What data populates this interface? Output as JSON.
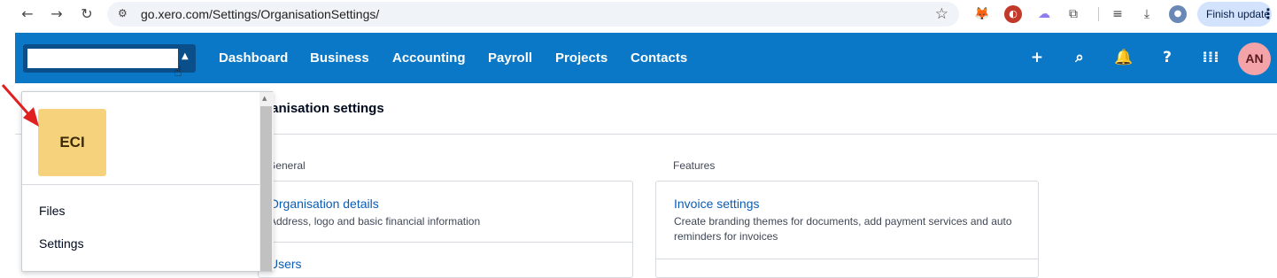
{
  "browser": {
    "back_icon": "←",
    "forward_icon": "→",
    "reload_icon": "↻",
    "site_info_icon": "⚙",
    "url": "go.xero.com/Settings/OrganisationSettings/",
    "bookmark_icon": "☆",
    "finish_update_label": "Finish update",
    "menu_icon": "⋮"
  },
  "header": {
    "org_name": "",
    "nav": [
      "Dashboard",
      "Business",
      "Accounting",
      "Payroll",
      "Projects",
      "Contacts"
    ],
    "user_initials": "AN",
    "colors": {
      "header_bg": "#0b78c7",
      "org_switch_bg": "#0a4e8a",
      "avatar_bg": "#f4a3a8"
    }
  },
  "page": {
    "title": "ganisation settings",
    "sections": [
      {
        "label": "General",
        "cards": [
          {
            "link": "Organisation details",
            "desc": "Address, logo and basic financial information"
          },
          {
            "link": "Users",
            "desc": ""
          }
        ]
      },
      {
        "label": "Features",
        "cards": [
          {
            "link": "Invoice settings",
            "desc": "Create branding themes for documents, add payment services and auto reminders for invoices"
          }
        ]
      }
    ]
  },
  "dropdown": {
    "org_initials": "ECI",
    "org_tile_color": "#f7d27c",
    "items": [
      "Files",
      "Settings"
    ]
  }
}
